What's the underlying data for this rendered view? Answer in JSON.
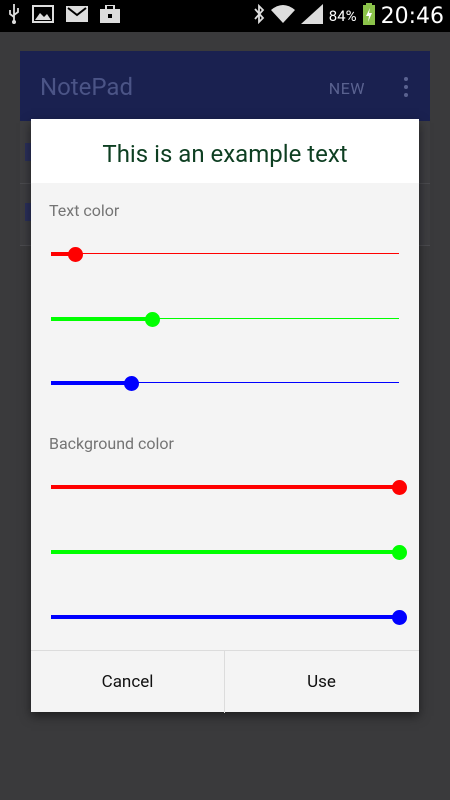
{
  "status_bar": {
    "battery_percent": "84%",
    "time": "20:46",
    "icons_left": [
      "usb-icon",
      "image-icon",
      "gmail-icon",
      "briefcase-icon"
    ],
    "icons_right": [
      "bluetooth-icon",
      "wifi-icon",
      "signal-icon",
      "battery-charging-icon"
    ]
  },
  "app_bar": {
    "title": "NotePad",
    "new_action": "NEW"
  },
  "dialog": {
    "preview_text": "This is an example text",
    "preview_text_color": "#0e3f22",
    "preview_background_color": "#ffffff",
    "text_color": {
      "label": "Text color",
      "red": {
        "color": "#ff0000",
        "value": 0.07
      },
      "green": {
        "color": "#00ff00",
        "value": 0.29
      },
      "blue": {
        "color": "#0000ff",
        "value": 0.23
      }
    },
    "background_color": {
      "label": "Background color",
      "red": {
        "color": "#ff0000",
        "value": 1.0
      },
      "green": {
        "color": "#00ff00",
        "value": 1.0
      },
      "blue": {
        "color": "#0000ff",
        "value": 1.0
      }
    },
    "cancel_label": "Cancel",
    "use_label": "Use"
  }
}
